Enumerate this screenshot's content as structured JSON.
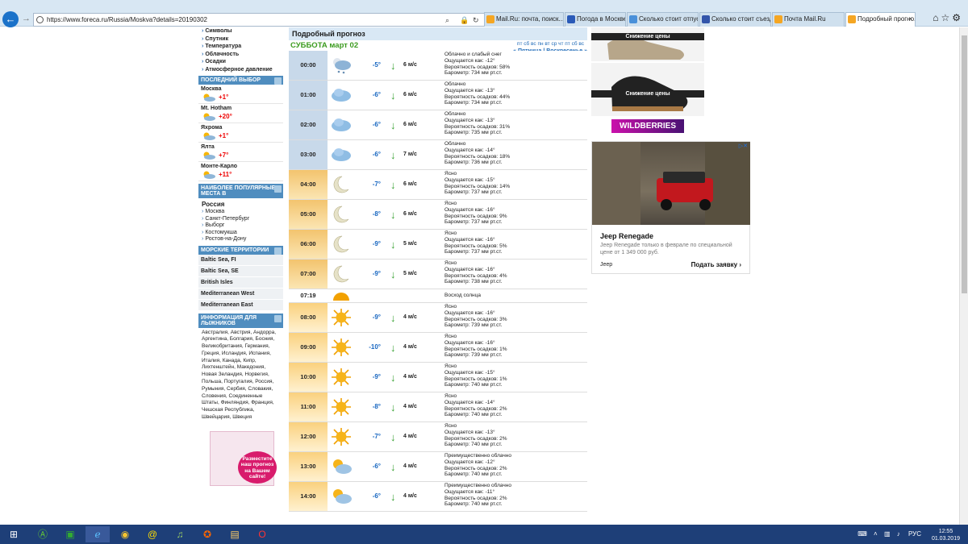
{
  "browser": {
    "url": "https://www.foreca.ru/Russia/Moskva?details=20190302",
    "tabs": [
      {
        "label": "Mail.Ru: почта, поиск...",
        "active": false
      },
      {
        "label": "Погода в Москве",
        "active": false
      },
      {
        "label": "Сколько стоит отпус...",
        "active": false
      },
      {
        "label": "Сколько стоит съезд...",
        "active": false
      },
      {
        "label": "Почта Mail.Ru",
        "active": false
      },
      {
        "label": "Подробный прогно...",
        "active": true
      }
    ]
  },
  "sidebar": {
    "links": [
      "Символы",
      "Спутник",
      "Температура",
      "Облачность",
      "Осадки",
      "Атмосферное давление"
    ],
    "recent_title": "ПОСЛЕДНИЙ ВЫБОР",
    "recent": [
      {
        "name": "Москва",
        "temp": "+1°"
      },
      {
        "name": "Mt. Hotham",
        "temp": "+20°"
      },
      {
        "name": "Яхрома",
        "temp": "+1°"
      },
      {
        "name": "Ялта",
        "temp": "+7°"
      },
      {
        "name": "Монте-Карло",
        "temp": "+11°"
      }
    ],
    "popular_title": "НАИБОЛЕЕ ПОПУЛЯРНЫЕ МЕСТА В",
    "country": "Россия",
    "popular": [
      "Москва",
      "Санкт-Петербург",
      "Выборг",
      "Костомукша",
      "Ростов-на-Дону"
    ],
    "sea_title": "МОРСКИЕ ТЕРРИТОРИИ",
    "seas": [
      "Baltic Sea, FI",
      "Baltic Sea, SE",
      "British Isles",
      "Mediterranean West",
      "Mediterranean East"
    ],
    "ski_title": "ИНФОРМАЦИЯ ДЛЯ ЛЫЖНИКОВ",
    "ski_text": "Австралия, Австрия, Андорра, Аргентина, Болгария, Босния, Великобритания, Германия, Греция, Исландия, Испания, Италия, Канада, Кипр, Лихтенштейн, Македония, Новая Зеландия, Норвегия, Польша, Португалия, Россия, Румыния, Сербия, Словакия, Словения, Соединенные Штаты, Финляндия, Франция, Чешская Республика, Швейцария, Швеция",
    "promo": "Разместите наш прогноз на Вашем сайте!"
  },
  "forecast": {
    "title": "Подробный прогноз",
    "day": "СУББОТА март 02",
    "day_links": "пт сб вс пн вт ср чт пт сб вс",
    "prev": "« Пятница",
    "sep": "|",
    "next": "Воскресенье »",
    "rows": [
      {
        "time": "00:00",
        "kind": "night",
        "icon": "cloud-snow-night",
        "temp": "-5°",
        "wind": "6 м/с",
        "desc": "Облачно и слабый снег",
        "feels": "Ощущается как: -12°",
        "precip": "Вероятность осадков: 58%",
        "baro": "Барометр: 734 мм рт.ст."
      },
      {
        "time": "01:00",
        "kind": "night",
        "icon": "cloud",
        "temp": "-6°",
        "wind": "6 м/с",
        "desc": "Облачно",
        "feels": "Ощущается как: -13°",
        "precip": "Вероятность осадков: 44%",
        "baro": "Барометр: 734 мм рт.ст."
      },
      {
        "time": "02:00",
        "kind": "night",
        "icon": "cloud",
        "temp": "-6°",
        "wind": "6 м/с",
        "desc": "Облачно",
        "feels": "Ощущается как: -13°",
        "precip": "Вероятность осадков: 31%",
        "baro": "Барометр: 735 мм рт.ст."
      },
      {
        "time": "03:00",
        "kind": "night",
        "icon": "cloud",
        "temp": "-6°",
        "wind": "7 м/с",
        "desc": "Облачно",
        "feels": "Ощущается как: -14°",
        "precip": "Вероятность осадков: 18%",
        "baro": "Барометр: 736 мм рт.ст."
      },
      {
        "time": "04:00",
        "kind": "dawn",
        "icon": "moon",
        "temp": "-7°",
        "wind": "6 м/с",
        "desc": "Ясно",
        "feels": "Ощущается как: -15°",
        "precip": "Вероятность осадков: 14%",
        "baro": "Барометр: 737 мм рт.ст."
      },
      {
        "time": "05:00",
        "kind": "dawn",
        "icon": "moon",
        "temp": "-8°",
        "wind": "6 м/с",
        "desc": "Ясно",
        "feels": "Ощущается как: -16°",
        "precip": "Вероятность осадков: 9%",
        "baro": "Барометр: 737 мм рт.ст."
      },
      {
        "time": "06:00",
        "kind": "dawn",
        "icon": "moon",
        "temp": "-9°",
        "wind": "5 м/с",
        "desc": "Ясно",
        "feels": "Ощущается как: -16°",
        "precip": "Вероятность осадков: 5%",
        "baro": "Барометр: 737 мм рт.ст."
      },
      {
        "time": "07:00",
        "kind": "dawn",
        "icon": "moon",
        "temp": "-9°",
        "wind": "5 м/с",
        "desc": "Ясно",
        "feels": "Ощущается как: -16°",
        "precip": "Вероятность осадков: 4%",
        "baro": "Барометр: 738 мм рт.ст."
      },
      {
        "time": "07:19",
        "kind": "sun",
        "icon": "sunrise",
        "desc": "Восход солнца"
      },
      {
        "time": "08:00",
        "kind": "day",
        "icon": "sun",
        "temp": "-9°",
        "wind": "4 м/с",
        "desc": "Ясно",
        "feels": "Ощущается как: -16°",
        "precip": "Вероятность осадков: 3%",
        "baro": "Барометр: 739 мм рт.ст."
      },
      {
        "time": "09:00",
        "kind": "day",
        "icon": "sun",
        "temp": "-10°",
        "wind": "4 м/с",
        "desc": "Ясно",
        "feels": "Ощущается как: -16°",
        "precip": "Вероятность осадков: 1%",
        "baro": "Барометр: 739 мм рт.ст."
      },
      {
        "time": "10:00",
        "kind": "day",
        "icon": "sun",
        "temp": "-9°",
        "wind": "4 м/с",
        "desc": "Ясно",
        "feels": "Ощущается как: -15°",
        "precip": "Вероятность осадков: 1%",
        "baro": "Барометр: 740 мм рт.ст."
      },
      {
        "time": "11:00",
        "kind": "day",
        "icon": "sun",
        "temp": "-8°",
        "wind": "4 м/с",
        "desc": "Ясно",
        "feels": "Ощущается как: -14°",
        "precip": "Вероятность осадков: 2%",
        "baro": "Барометр: 740 мм рт.ст."
      },
      {
        "time": "12:00",
        "kind": "day",
        "icon": "sun",
        "temp": "-7°",
        "wind": "4 м/с",
        "desc": "Ясно",
        "feels": "Ощущается как: -13°",
        "precip": "Вероятность осадков: 2%",
        "baro": "Барометр: 740 мм рт.ст."
      },
      {
        "time": "13:00",
        "kind": "day",
        "icon": "sun-cloud",
        "temp": "-6°",
        "wind": "4 м/с",
        "desc": "Преимущественно облачно",
        "feels": "Ощущается как: -12°",
        "precip": "Вероятность осадков: 2%",
        "baro": "Барометр: 740 мм рт.ст."
      },
      {
        "time": "14:00",
        "kind": "day",
        "icon": "sun-cloud",
        "temp": "-6°",
        "wind": "4 м/с",
        "desc": "Преимущественно облачно",
        "feels": "Ощущается как: -11°",
        "precip": "Вероятность осадков: 2%",
        "baro": "Барометр: 740 мм рт.ст."
      }
    ]
  },
  "ads": {
    "shoe_label": "Снижение цены",
    "shop": "WILDBERRIES",
    "card_title": "Jeep Renegade",
    "card_desc": "Jeep Renegade только в феврале по специальной цене от 1 349 000 руб.",
    "card_brand": "Jeep",
    "card_cta": "Подать заявку"
  },
  "taskbar": {
    "lang": "РУС",
    "time": "12:55",
    "date": "01.03.2019"
  },
  "colors": {
    "accent": "#1b72c9",
    "day_green": "#3b9b1f",
    "temp_blue": "#1565c0",
    "recent_red": "#e00000"
  }
}
